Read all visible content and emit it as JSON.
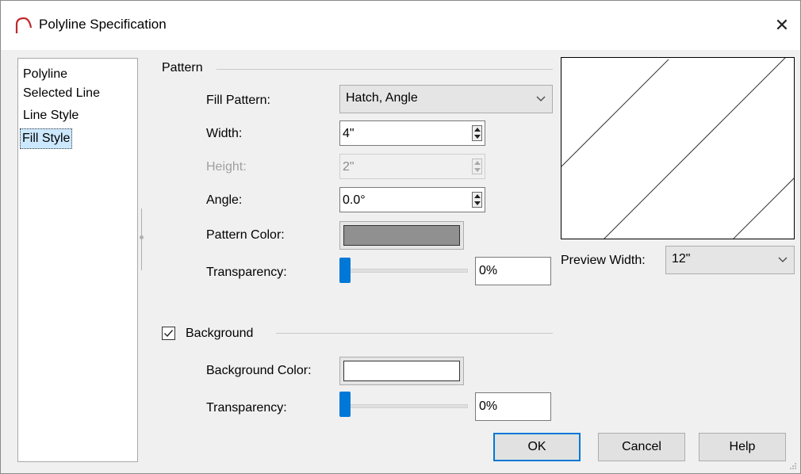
{
  "window": {
    "title": "Polyline Specification",
    "close_glyph": "✕",
    "icon": "arc-icon"
  },
  "tree": {
    "items": [
      {
        "label": "Polyline",
        "selected": false
      },
      {
        "label": "Selected Line",
        "selected": false
      },
      {
        "label": "Line Style",
        "selected": false
      },
      {
        "label": "Fill Style",
        "selected": true
      }
    ]
  },
  "pattern": {
    "group_label": "Pattern",
    "fill_pattern": {
      "label": "Fill Pattern:",
      "value": "Hatch, Angle"
    },
    "width": {
      "label": "Width:",
      "value": "4\""
    },
    "height": {
      "label": "Height:",
      "value": "2\"",
      "disabled": true
    },
    "angle": {
      "label": "Angle:",
      "value": "0.0°"
    },
    "pattern_color": {
      "label": "Pattern Color:",
      "color": "#909090"
    },
    "transparency": {
      "label": "Transparency:",
      "value": "0%",
      "level": 0
    }
  },
  "preview": {
    "width_label": "Preview Width:",
    "width_value": "12\""
  },
  "background": {
    "label": "Background",
    "checked": true,
    "color": {
      "label": "Background Color:",
      "color": "#ffffff"
    },
    "transparency": {
      "label": "Transparency:",
      "value": "0%",
      "level": 0
    }
  },
  "buttons": {
    "ok": "OK",
    "cancel": "Cancel",
    "help": "Help"
  },
  "colors": {
    "accent": "#0078d7",
    "selection": "#cce8ff"
  }
}
